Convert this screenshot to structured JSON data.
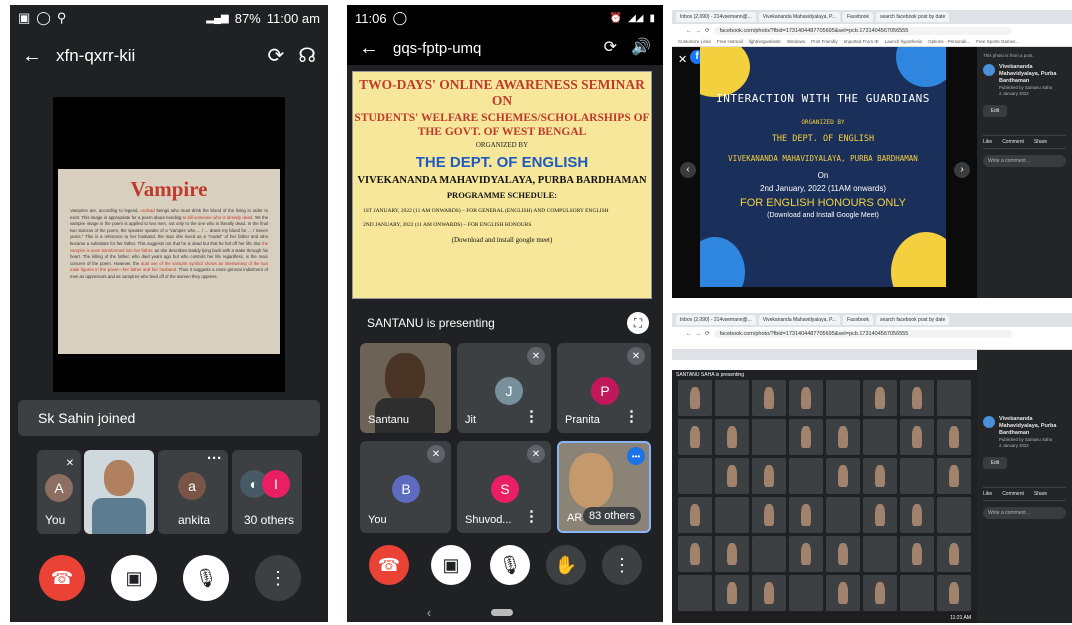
{
  "phone1": {
    "status": {
      "battery": "87%",
      "time": "11:00 am"
    },
    "meeting_code": "xfn-qxrr-kii",
    "shared_doc": {
      "title": "Vampire",
      "body_1": "Vampires are, according to legend,",
      "body_2": "undead",
      "body_3": "beings who must drink the blood of the living in order to exist. This image is appropriate for a poem about needing",
      "body_4": "to kill someone who is already dead.",
      "body_5": "Yet the vampire image in the poem is applied to two men, not only to the one who is literally dead. In the final two stanzas of the poem, the speaker speaks of a \"vampire who ... / ... drank my blood for ... / Seven years.\" This is a reference to her husband, the man she loved as a \"model\" of her father and who became a substitute for her father. This suggests not that he is dead but that he fed off her life. But",
      "body_6": "the vampire is soon transformed into her father,",
      "body_7": "as she describes Daddy lying back with a stake through his heart. The killing of the father, who died years ago but who controls her life regardless, is the main concern of the poem. However, the",
      "body_8": "dual use of the vampire symbol shows an intertwining of the two male figures in the poem—her father and her husband.",
      "body_9": "Thus it suggests a more general indictment of men as oppressors and as vampires who feed off of the women they oppress."
    },
    "toast": "Sk Sahin joined",
    "tiles": [
      {
        "label": "You",
        "initial": "A",
        "color": "#8d6e63"
      },
      {
        "label": "",
        "initial": "",
        "color": ""
      },
      {
        "label": "ankita",
        "initial": "a",
        "color": "#795548"
      },
      {
        "label": "30 others",
        "initial": "I",
        "color": "#e91e63"
      }
    ]
  },
  "phone2": {
    "status": {
      "time": "11:06"
    },
    "meeting_code": "gqs-fptp-umq",
    "poster": {
      "title_1": "TWO-DAYS' ONLINE AWARENESS SEMINAR",
      "title_2": "ON",
      "subject_1": "STUDENTS' WELFARE SCHEMES/SCHOLARSHIPS OF",
      "subject_2": "THE GOVT. OF WEST BENGAL",
      "organized": "ORGANIZED BY",
      "dept": "THE DEPT. OF ENGLISH",
      "college": "VIVEKANANDA MAHAVIDYALAYA, PURBA BARDHAMAN",
      "schedule": "PROGRAMME SCHEDULE:",
      "prog_1": "1ST JANUARY, 2022 (11 AM ONWARDS) – FOR GENERAL (ENGLISH) AND COMPULSORY ENGLISH",
      "prog_2": "2ND JANUARY, 2022 (11 AM ONWARDS) – FOR ENGLISH HONOURS",
      "download": "(Download and install google meet)"
    },
    "presenting": "SANTANU is presenting",
    "tiles": [
      {
        "label": "Santanu",
        "initial": "",
        "color": ""
      },
      {
        "label": "Jit",
        "initial": "J",
        "color": "#78909c"
      },
      {
        "label": "Pranita",
        "initial": "P",
        "color": "#c2185b"
      },
      {
        "label": "You",
        "initial": "B",
        "color": "#5c6bc0"
      },
      {
        "label": "Shuvod...",
        "initial": "S",
        "color": "#e91e63"
      },
      {
        "label": "AR",
        "initial": "",
        "color": ""
      }
    ],
    "others": "83 others"
  },
  "browser1": {
    "tabs": [
      "Inbox (2,090) - 214vsemann@...",
      "Vivekananda Mahavidyalaya, P...",
      "Facebook",
      "search facebook post by date"
    ],
    "url": "facebook.com/photo/?fbid=1731404487705695&set=pcb.1731404567056555",
    "bookmarks": [
      "Customize Links",
      "Free Hotmail",
      "lightningwebsite",
      "Windows",
      "Print Friendly",
      "Imported From IE",
      "Launch hypothesis",
      "Options - Personali...",
      "Free Sports Games..."
    ],
    "poster": {
      "title": "INTERACTION WITH THE GUARDIANS",
      "organized": "ORGANIZED BY",
      "dept": "THE DEPT. OF ENGLISH",
      "college": "VIVEKANANDA MAHAVIDYALAYA, PURBA BARDHAMAN",
      "on": "On",
      "date": "2nd January, 2022 (11AM onwards)",
      "only": "FOR ENGLISH HONOURS ONLY",
      "download": "(Download and Install Google Meet)"
    },
    "side": {
      "from_post": "This photo is from a post.",
      "page": "Vivekananda Mahavidyalaya, Purba Bardhaman",
      "published": "Published by Santanu Saha",
      "date": "2 January 2022",
      "edit": "Edit",
      "like": "Like",
      "comment": "Comment",
      "share": "Share",
      "write": "Write a comment..."
    }
  },
  "browser2": {
    "tabs": [
      "Inbox (2,090) - 214vsemann@...",
      "Vivekananda Mahavidyalaya, P...",
      "Facebook",
      "search facebook post by date"
    ],
    "url": "facebook.com/photo/?fbid=1731404487705695&set=pcb.1731404567056555",
    "inner_label": "SANTANU SAHA is presenting",
    "taskbar_time": "11:21 AM",
    "side": {
      "page": "Vivekananda Mahavidyalaya, Purba Bardhaman",
      "published": "Published by Santanu Saha",
      "date": "2 January 2022",
      "edit": "Edit",
      "like": "Like",
      "comment": "Comment",
      "share": "Share",
      "write": "Write a comment..."
    }
  }
}
